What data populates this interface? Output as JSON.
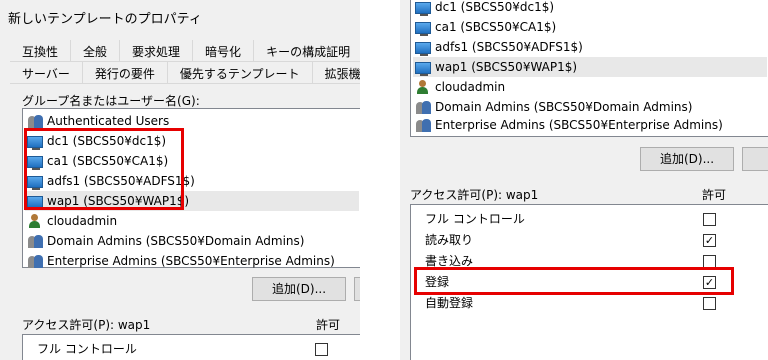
{
  "left": {
    "title": "新しいテンプレートのプロパティ",
    "tabs_row1": [
      "互換性",
      "全般",
      "要求処理",
      "暗号化",
      "キーの構成証明"
    ],
    "tabs_row2": [
      "サーバー",
      "発行の要件",
      "優先するテンプレート",
      "拡張機能"
    ],
    "group_label": "グループ名またはユーザー名(G):",
    "items": [
      {
        "label": "Authenticated Users",
        "icon": "group-icon"
      },
      {
        "label": "dc1 (SBCS50¥dc1$)",
        "icon": "computer-icon"
      },
      {
        "label": "ca1 (SBCS50¥CA1$)",
        "icon": "computer-icon"
      },
      {
        "label": "adfs1 (SBCS50¥ADFS1$)",
        "icon": "computer-icon"
      },
      {
        "label": "wap1 (SBCS50¥WAP1$)",
        "icon": "computer-icon"
      },
      {
        "label": "cloudadmin",
        "icon": "user-icon"
      },
      {
        "label": "Domain Admins (SBCS50¥Domain Admins)",
        "icon": "group-icon"
      },
      {
        "label": "Enterprise Admins (SBCS50¥Enterprise Admins)",
        "icon": "group-icon"
      }
    ],
    "add_button": "追加(D)...",
    "perm_label": "アクセス許可(P): wap1",
    "allow_label": "許可",
    "first_perm": "フル コントロール"
  },
  "right": {
    "items": [
      {
        "label": "dc1 (SBCS50¥dc1$)",
        "icon": "computer-icon"
      },
      {
        "label": "ca1 (SBCS50¥CA1$)",
        "icon": "computer-icon"
      },
      {
        "label": "adfs1 (SBCS50¥ADFS1$)",
        "icon": "computer-icon"
      },
      {
        "label": "wap1 (SBCS50¥WAP1$)",
        "icon": "computer-icon"
      },
      {
        "label": "cloudadmin",
        "icon": "user-icon"
      },
      {
        "label": "Domain Admins (SBCS50¥Domain Admins)",
        "icon": "group-icon"
      },
      {
        "label": "Enterprise Admins (SBCS50¥Enterprise Admins)",
        "icon": "group-icon"
      }
    ],
    "add_button": "追加(D)...",
    "perm_label": "アクセス許可(P): wap1",
    "allow_label": "許可",
    "permissions": [
      {
        "label": "フル コントロール",
        "allowed": false
      },
      {
        "label": "読み取り",
        "allowed": true
      },
      {
        "label": "書き込み",
        "allowed": false
      },
      {
        "label": "登録",
        "allowed": true
      },
      {
        "label": "自動登録",
        "allowed": false
      }
    ]
  },
  "colors": {
    "highlight": "#e60000",
    "selection": "#e8e8e8"
  }
}
